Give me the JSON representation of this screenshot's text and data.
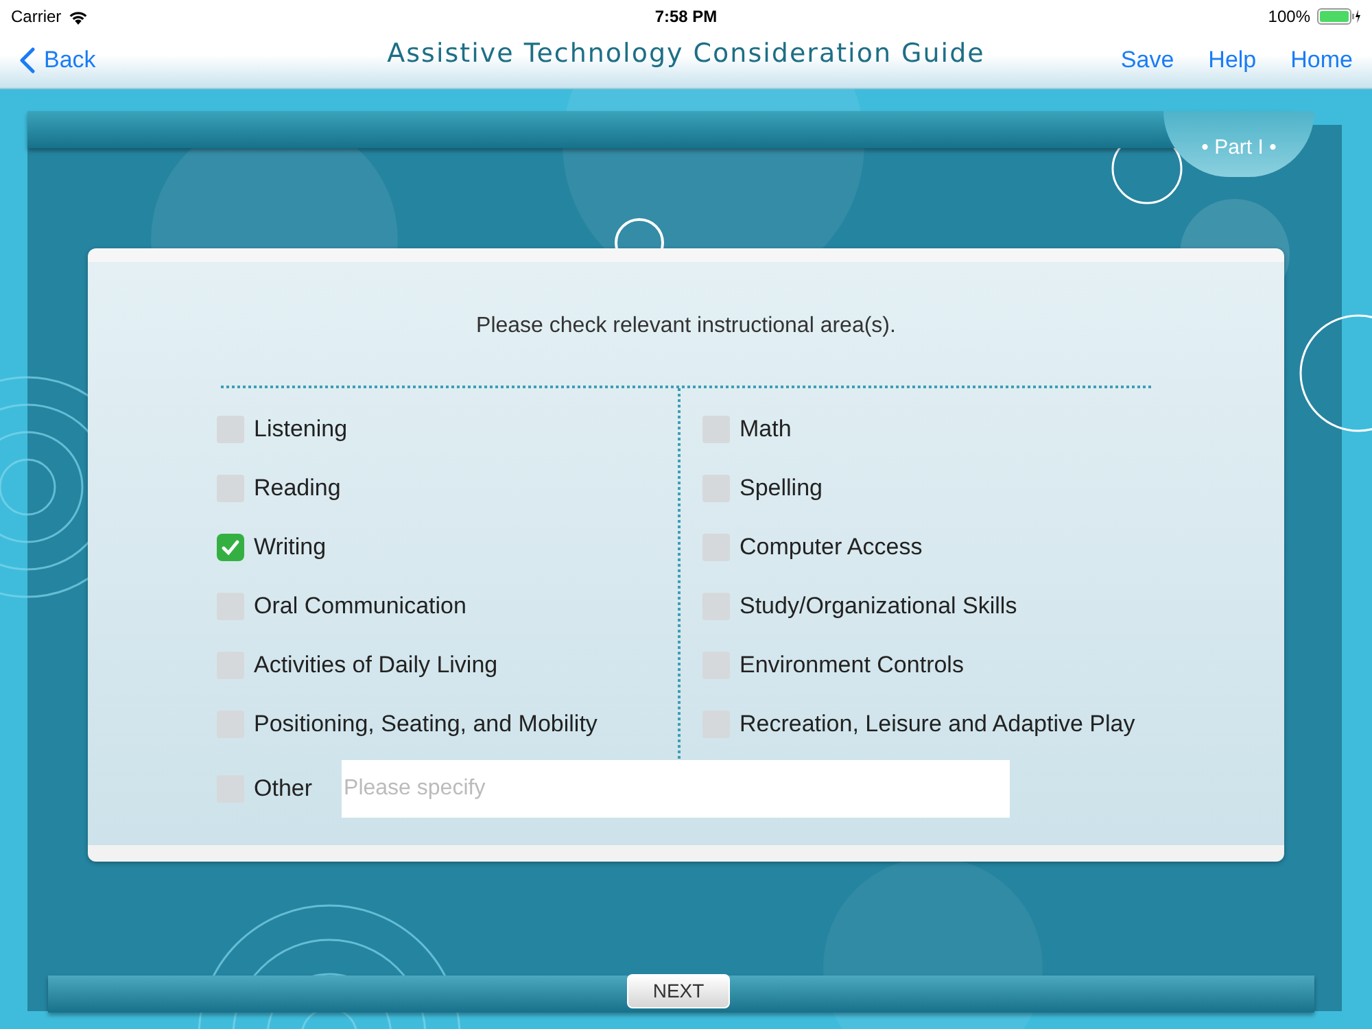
{
  "status_bar": {
    "carrier": "Carrier",
    "time": "7:58 PM",
    "battery": "100%"
  },
  "nav": {
    "back": "Back",
    "title": "Assistive Technology Consideration Guide",
    "actions": [
      "Save",
      "Help",
      "Home"
    ]
  },
  "part_tab": "• Part I •",
  "prompt": "Please check relevant instructional area(s).",
  "columns": [
    [
      {
        "label": "Listening",
        "checked": false
      },
      {
        "label": "Reading",
        "checked": false
      },
      {
        "label": "Writing",
        "checked": true
      },
      {
        "label": "Oral Communication",
        "checked": false
      },
      {
        "label": "Activities of Daily Living",
        "checked": false
      },
      {
        "label": "Positioning, Seating, and Mobility",
        "checked": false
      }
    ],
    [
      {
        "label": "Math",
        "checked": false
      },
      {
        "label": "Spelling",
        "checked": false
      },
      {
        "label": "Computer Access",
        "checked": false
      },
      {
        "label": "Study/Organizational Skills",
        "checked": false
      },
      {
        "label": "Environment Controls",
        "checked": false
      },
      {
        "label": "Recreation, Leisure and Adaptive Play",
        "checked": false
      }
    ]
  ],
  "other": {
    "label": "Other",
    "checked": false,
    "placeholder": "Please specify"
  },
  "next": "NEXT"
}
